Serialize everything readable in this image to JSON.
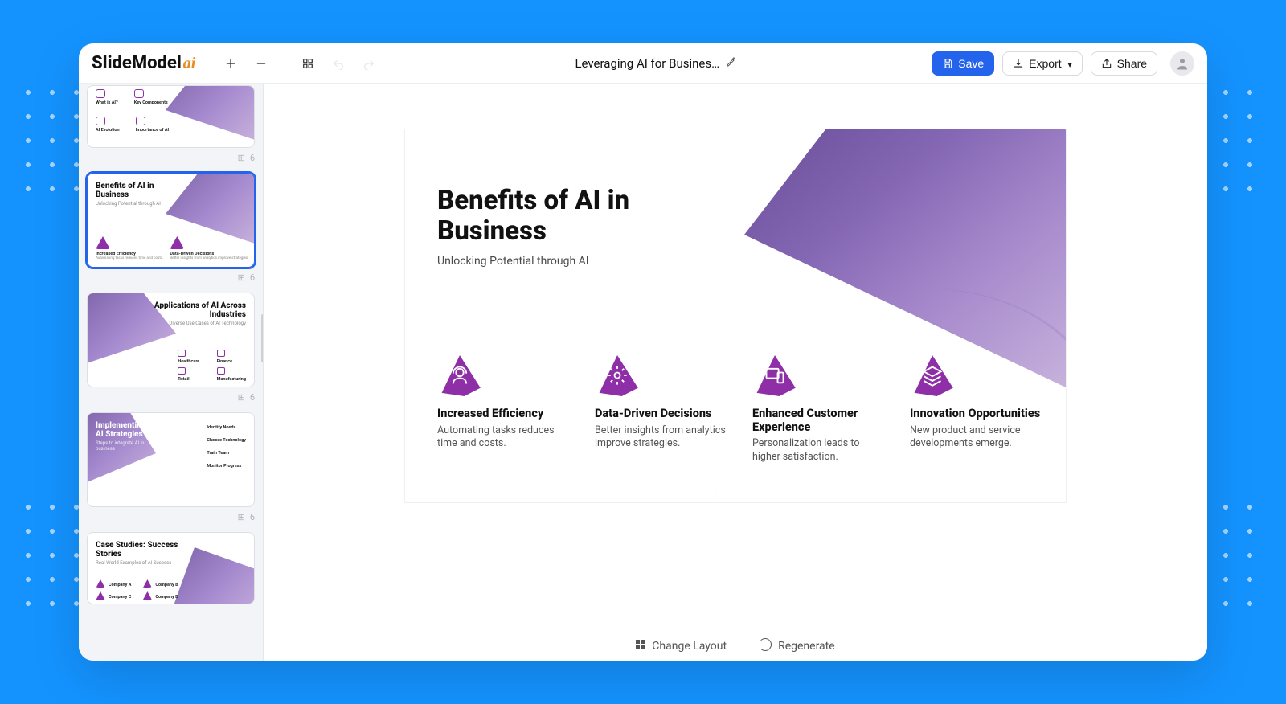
{
  "brand": {
    "name": "SlideModel",
    "suffix": "ai"
  },
  "toolbar": {
    "add_tooltip": "Add slide",
    "remove_tooltip": "Remove slide",
    "layout_tooltip": "Layouts",
    "undo_tooltip": "Undo",
    "redo_tooltip": "Redo"
  },
  "document": {
    "title": "Leveraging AI for Busines…"
  },
  "actions": {
    "save": "Save",
    "export": "Export",
    "share": "Share",
    "change_layout": "Change Layout",
    "regenerate": "Regenerate"
  },
  "thumbnail_meta": {
    "layout_icon": "⊞",
    "item_count": "6"
  },
  "thumbnails": [
    {
      "title": "",
      "items": []
    },
    {
      "title": "Benefits of AI in Business",
      "subtitle": "Unlocking Potential through AI",
      "items": [
        {
          "label": "Increased Efficiency",
          "desc": "Automating tasks reduces time and costs."
        },
        {
          "label": "Data-Driven Decisions",
          "desc": "Better insights from analytics improve strategies."
        },
        {
          "label": "Enhanced Customer Experience",
          "desc": "Personalization leads to higher satisfaction."
        },
        {
          "label": "Innovation Opportunities",
          "desc": "New product and service developments emerge."
        }
      ]
    },
    {
      "title": "Applications of AI Across Industries",
      "subtitle": "Diverse Use Cases of AI Technology",
      "items": [
        {
          "label": "Healthcare",
          "desc": ""
        },
        {
          "label": "Finance",
          "desc": ""
        },
        {
          "label": "Retail",
          "desc": ""
        },
        {
          "label": "Manufacturing",
          "desc": ""
        }
      ]
    },
    {
      "title": "Implementing AI Strategies",
      "subtitle": "Steps to integrate AI in business",
      "items": [
        {
          "label": "Identify Needs",
          "desc": ""
        },
        {
          "label": "Choose Technology",
          "desc": ""
        },
        {
          "label": "Train Team",
          "desc": ""
        },
        {
          "label": "Monitor Progress",
          "desc": ""
        }
      ]
    },
    {
      "title": "Case Studies: Success Stories",
      "subtitle": "Real-World Examples of AI Success",
      "items": [
        {
          "label": "Company A",
          "desc": ""
        },
        {
          "label": "Company B",
          "desc": ""
        },
        {
          "label": "Company C",
          "desc": ""
        },
        {
          "label": "Company D",
          "desc": ""
        }
      ]
    }
  ],
  "slide": {
    "title": "Benefits of AI in Business",
    "subtitle": "Unlocking Potential through AI",
    "features": [
      {
        "icon": "person-headset-icon",
        "title": "Increased Efficiency",
        "desc": "Automating tasks reduces time and costs."
      },
      {
        "icon": "gear-icon",
        "title": "Data-Driven Decisions",
        "desc": "Better insights from analytics improve strategies."
      },
      {
        "icon": "devices-icon",
        "title": "Enhanced Customer Experience",
        "desc": "Personalization leads to higher satisfaction."
      },
      {
        "icon": "layers-icon",
        "title": "Innovation Opportunities",
        "desc": "New product and service developments emerge."
      }
    ]
  }
}
